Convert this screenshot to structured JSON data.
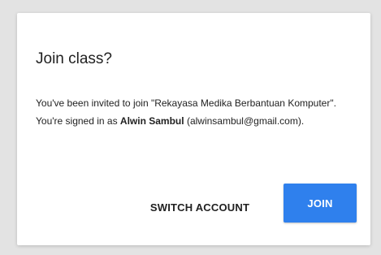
{
  "dialog": {
    "title": "Join class?",
    "message": {
      "part1": "You've been invited to join \"Rekayasa Medika Berbantuan Komputer\". You're signed in as ",
      "user_name": "Alwin Sambul",
      "part2": " (alwinsambul@gmail.com)."
    },
    "switch_account_label": "SWITCH ACCOUNT",
    "join_label": "JOIN"
  },
  "colors": {
    "background": "#e3e3e3",
    "dialog_bg": "#ffffff",
    "join_button": "#2f80ed",
    "text": "#212121"
  }
}
